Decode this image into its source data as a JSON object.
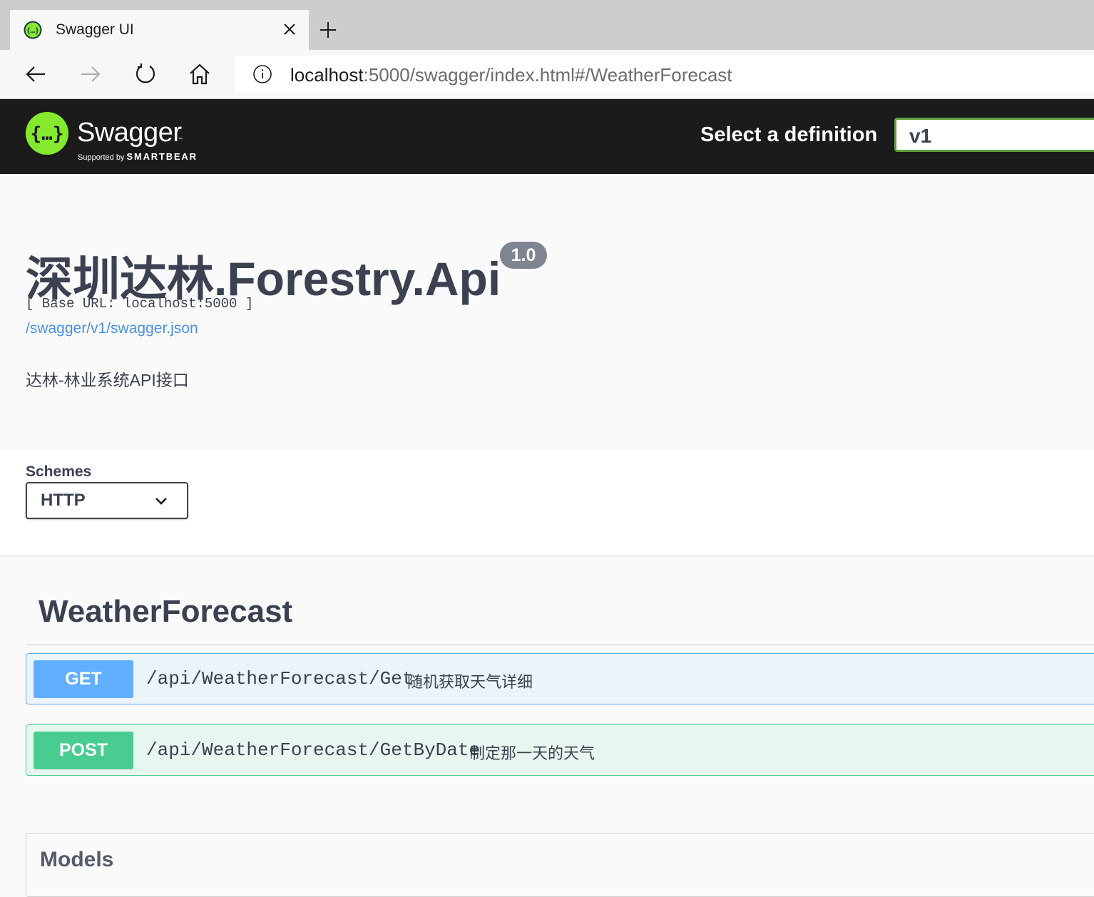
{
  "browser": {
    "tab_title": "Swagger UI",
    "url_host": "localhost",
    "url_rest": ":5000/swagger/index.html#/WeatherForecast"
  },
  "topbar": {
    "logo_text": "Swagger",
    "logo_supported": "Supported by",
    "logo_brand": "SMARTBEAR",
    "definition_label": "Select a definition",
    "definition_value": "v1"
  },
  "info": {
    "title": "深圳达林.Forestry.Api",
    "version": "1.0",
    "base_url": "[ Base URL: localhost:5000 ]",
    "spec_link": "/swagger/v1/swagger.json",
    "description": "达林-林业系统API接口"
  },
  "schemes": {
    "label": "Schemes",
    "value": "HTTP"
  },
  "tag": {
    "name": "WeatherForecast",
    "operations": [
      {
        "method": "GET",
        "path": "/api/WeatherForecast/Get",
        "summary": "随机获取天气详细"
      },
      {
        "method": "POST",
        "path": "/api/WeatherForecast/GetByDate",
        "summary": "制定那一天的天气"
      }
    ]
  },
  "models": {
    "title": "Models"
  },
  "colors": {
    "get": "#61affe",
    "post": "#49cc90",
    "topbar": "#1b1b1b",
    "logo_green": "#85ea2d",
    "text": "#3b4151",
    "link": "#4990e2"
  }
}
